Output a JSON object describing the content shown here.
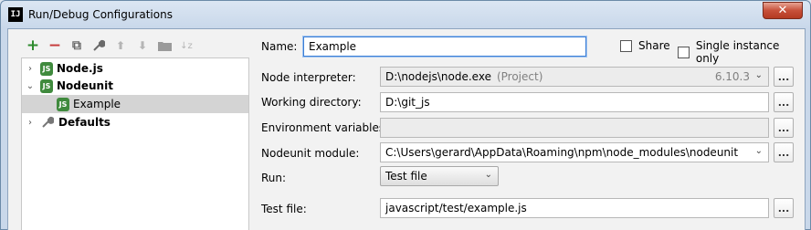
{
  "window": {
    "app_icon_text": "IJ",
    "title": "Run/Debug Configurations",
    "close_glyph": "✕"
  },
  "toolbar": {
    "icons": [
      "add-icon",
      "remove-icon",
      "copy-icon",
      "wrench-icon",
      "move-up-icon",
      "move-down-icon",
      "folder-icon",
      "sort-icon"
    ],
    "add_glyph": "+",
    "remove_glyph": "−",
    "copy_glyph": "⧉",
    "wrench_glyph": "🔧",
    "up_glyph": "⬆",
    "down_glyph": "⬇",
    "folder_glyph": "▬",
    "sort_glyph": "↓z"
  },
  "tree": {
    "items": [
      {
        "label": "Node.js",
        "expander": ">",
        "icon": "nodejs-icon"
      },
      {
        "label": "Nodeunit",
        "expander": "v",
        "icon": "nodeunit-icon"
      },
      {
        "label": "Example",
        "expander": "",
        "icon": "nodeunit-config-icon"
      },
      {
        "label": "Defaults",
        "expander": ">",
        "icon": "defaults-wrench-icon"
      }
    ]
  },
  "form": {
    "name_label": "Name:",
    "name_value": "Example",
    "share_label": "Share",
    "single_instance_label": "Single instance only",
    "node_interpreter_label": "Node interpreter:",
    "node_interpreter_value": "D:\\nodejs\\node.exe",
    "node_interpreter_hint": "(Project)",
    "node_version": "6.10.3",
    "working_directory_label": "Working directory:",
    "working_directory_value": "D:\\git_js",
    "env_vars_label": "Environment variables:",
    "env_vars_value": "",
    "nodeunit_module_label": "Nodeunit module:",
    "nodeunit_module_value": "C:\\Users\\gerard\\AppData\\Roaming\\npm\\node_modules\\nodeunit",
    "run_label": "Run:",
    "run_value": "Test file",
    "test_file_label": "Test file:",
    "test_file_value": "javascript/test/example.js",
    "browse_label": "..."
  },
  "colors": {
    "accent": "#3d7fd6",
    "node_green": "#3f8a3d",
    "close_red": "#c7503a"
  }
}
